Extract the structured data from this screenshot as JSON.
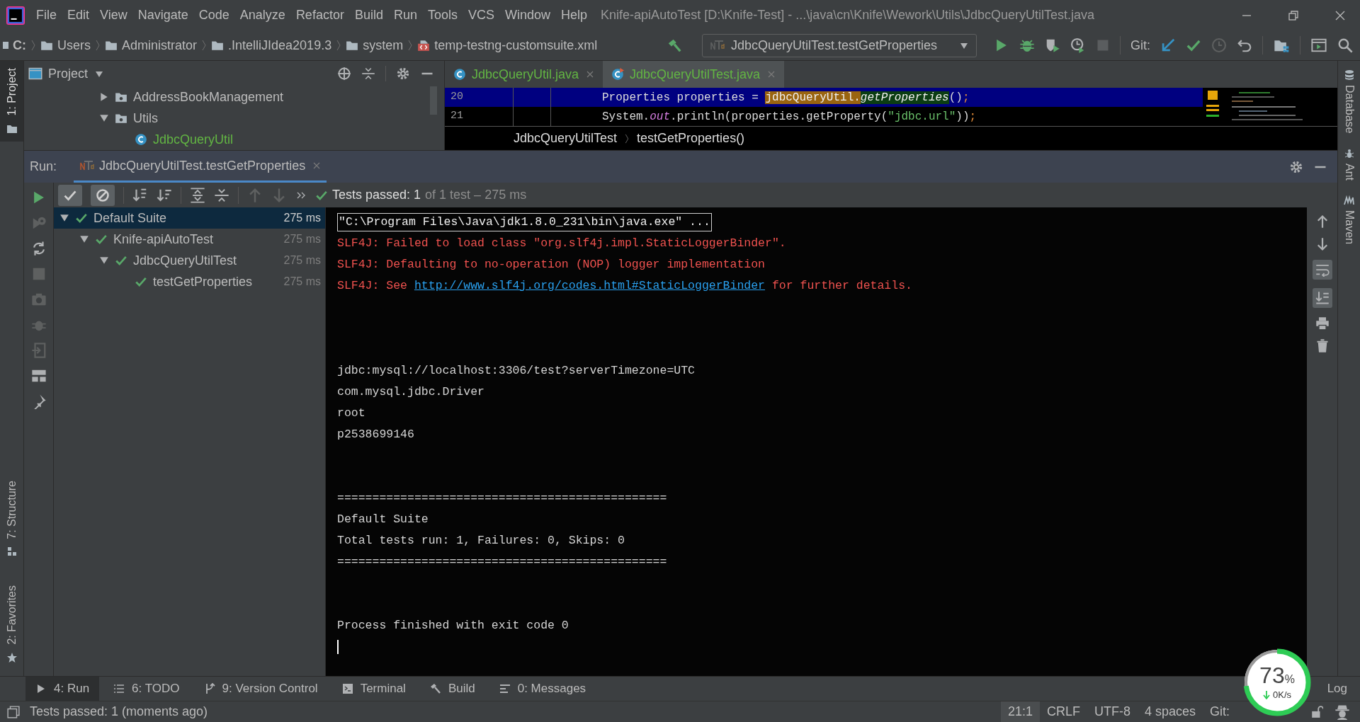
{
  "menu": [
    "File",
    "Edit",
    "View",
    "Navigate",
    "Code",
    "Analyze",
    "Refactor",
    "Build",
    "Run",
    "Tools",
    "VCS",
    "Window",
    "Help"
  ],
  "window_title": "Knife-apiAutoTest [D:\\Knife-Test] - ...\\java\\cn\\Knife\\Wework\\Utils\\JdbcQueryUtilTest.java",
  "breadcrumb": [
    {
      "kind": "drive",
      "label": "C:"
    },
    {
      "kind": "folder",
      "label": "Users"
    },
    {
      "kind": "folder",
      "label": "Administrator"
    },
    {
      "kind": "folder",
      "label": ".IntelliJIdea2019.3"
    },
    {
      "kind": "folder",
      "label": "system"
    },
    {
      "kind": "xml",
      "label": "temp-testng-customsuite.xml"
    }
  ],
  "run_config": {
    "label": "JdbcQueryUtilTest.testGetProperties"
  },
  "vcs_label": "Git:",
  "left_stripe": [
    {
      "label": "1: Project",
      "selected": true,
      "kind": "project"
    },
    {
      "label": "7: Structure",
      "selected": false,
      "kind": "structure"
    },
    {
      "label": "2: Favorites",
      "selected": false,
      "kind": "favorites"
    }
  ],
  "right_stripe": [
    {
      "label": "Database",
      "selected": false,
      "kind": "database"
    },
    {
      "label": "Ant",
      "selected": false,
      "kind": "ant"
    },
    {
      "label": "Maven",
      "selected": false,
      "kind": "maven"
    }
  ],
  "project_panel": {
    "title": "Project",
    "tree": [
      {
        "label": "AddressBookManagement",
        "kind": "package",
        "expanded": false
      },
      {
        "label": "Utils",
        "kind": "package",
        "expanded": true,
        "children": [
          {
            "label": "JdbcQueryUtil",
            "kind": "class"
          }
        ]
      }
    ]
  },
  "editor": {
    "tabs": [
      {
        "label": "JdbcQueryUtil.java",
        "selected": false,
        "kind": "class"
      },
      {
        "label": "JdbcQueryUtilTest.java",
        "selected": true,
        "kind": "test_class"
      }
    ],
    "lines": [
      {
        "number": "20",
        "current": true,
        "segments": [
          {
            "kind": "plain",
            "text": "Properties properties = "
          },
          {
            "kind": "usage",
            "text": "jdbcQueryUtil."
          },
          {
            "kind": "method",
            "text": "getProperties"
          },
          {
            "kind": "plain",
            "text": "()"
          },
          {
            "kind": "punct",
            "text": ";"
          }
        ]
      },
      {
        "number": "21",
        "current": false,
        "segments": [
          {
            "kind": "plain",
            "text": "System."
          },
          {
            "kind": "static",
            "text": "out"
          },
          {
            "kind": "plain",
            "text": ".println(properties.getProperty("
          },
          {
            "kind": "string",
            "text": "\"jdbc.url\""
          },
          {
            "kind": "plain",
            "text": "))"
          },
          {
            "kind": "punct",
            "text": ";"
          }
        ]
      }
    ],
    "breadcrumb": [
      "JdbcQueryUtilTest",
      "testGetProperties()"
    ]
  },
  "run_panel": {
    "label": "Run:",
    "tabs": [
      {
        "label": "JdbcQueryUtilTest.testGetProperties",
        "selected": true
      }
    ],
    "filters": [
      {
        "kind": "passed",
        "on": true
      },
      {
        "kind": "ignored",
        "on": true
      }
    ],
    "status": "Tests passed: 1",
    "status_detail": "of 1 test – 275 ms",
    "tree": [
      {
        "label": "Default Suite",
        "time": "275 ms",
        "passed": true,
        "selected": true,
        "expanded": true,
        "children": [
          {
            "label": "Knife-apiAutoTest",
            "time": "275 ms",
            "passed": true,
            "selected": false,
            "expanded": true,
            "children": [
              {
                "label": "JdbcQueryUtilTest",
                "time": "275 ms",
                "passed": true,
                "selected": false,
                "expanded": true,
                "children": [
                  {
                    "label": "testGetProperties",
                    "time": "275 ms",
                    "passed": true,
                    "selected": false
                  }
                ]
              }
            ]
          }
        ]
      }
    ],
    "console": [
      {
        "kind": "command",
        "text": "\"C:\\Program Files\\Java\\jdk1.8.0_231\\bin\\java.exe\" ..."
      },
      {
        "kind": "error",
        "text": "SLF4J: Failed to load class \"org.slf4j.impl.StaticLoggerBinder\"."
      },
      {
        "kind": "error",
        "text": "SLF4J: Defaulting to no-operation (NOP) logger implementation"
      },
      {
        "kind": "error_link",
        "before": "SLF4J: See ",
        "link": "http://www.slf4j.org/codes.html#StaticLoggerBinder",
        "after": " for further details."
      },
      {
        "kind": "blank"
      },
      {
        "kind": "blank"
      },
      {
        "kind": "blank"
      },
      {
        "kind": "plain",
        "text": "jdbc:mysql://localhost:3306/test?serverTimezone=UTC"
      },
      {
        "kind": "plain",
        "text": "com.mysql.jdbc.Driver"
      },
      {
        "kind": "plain",
        "text": "root"
      },
      {
        "kind": "plain",
        "text": "p2538699146"
      },
      {
        "kind": "blank"
      },
      {
        "kind": "blank"
      },
      {
        "kind": "plain",
        "text": "==============================================="
      },
      {
        "kind": "plain",
        "text": "Default Suite"
      },
      {
        "kind": "plain",
        "text": "Total tests run: 1, Failures: 0, Skips: 0"
      },
      {
        "kind": "plain",
        "text": "==============================================="
      },
      {
        "kind": "blank"
      },
      {
        "kind": "blank"
      },
      {
        "kind": "plain",
        "text": "Process finished with exit code 0"
      }
    ]
  },
  "tool_tabs": [
    {
      "label": "4: Run",
      "kind": "run",
      "selected": true
    },
    {
      "label": "6: TODO",
      "kind": "todo",
      "selected": false
    },
    {
      "label": "9: Version Control",
      "kind": "vcs",
      "selected": false
    },
    {
      "label": "Terminal",
      "kind": "terminal",
      "selected": false
    },
    {
      "label": "Build",
      "kind": "build",
      "selected": false
    },
    {
      "label": "0: Messages",
      "kind": "messages",
      "selected": false
    }
  ],
  "event_log": "Log",
  "status_bar": {
    "message": "Tests passed: 1 (moments ago)",
    "items": [
      "21:1",
      "CRLF",
      "UTF-8",
      "4 spaces",
      "Git:"
    ]
  },
  "speed_widget": {
    "percent": "73",
    "unit": "%",
    "speed": "0K/s"
  }
}
